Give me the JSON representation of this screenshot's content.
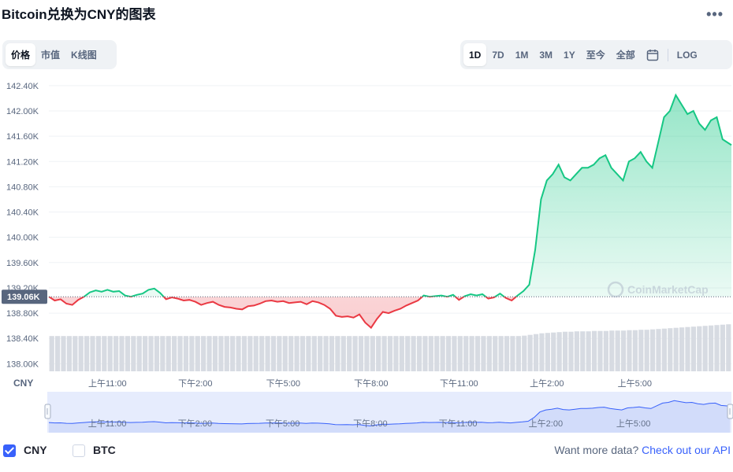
{
  "title": "Bitcoin兑换为CNY的图表",
  "more_icon": "more-horizontal-icon",
  "view_tabs": [
    {
      "label": "价格",
      "active": true
    },
    {
      "label": "市值",
      "active": false
    },
    {
      "label": "K线图",
      "active": false
    }
  ],
  "range_tabs": [
    {
      "label": "1D",
      "active": true
    },
    {
      "label": "7D",
      "active": false
    },
    {
      "label": "1M",
      "active": false
    },
    {
      "label": "3M",
      "active": false
    },
    {
      "label": "1Y",
      "active": false
    },
    {
      "label": "至今",
      "active": false
    },
    {
      "label": "全部",
      "active": false
    }
  ],
  "calendar_icon": "calendar-icon",
  "log_label": "LOG",
  "watermark": "CoinMarketCap",
  "colors": {
    "up": "#16c784",
    "down": "#ea3943",
    "accent": "#3861fb",
    "volume": "#d7dbe2",
    "navigator": "#e6ecfd"
  },
  "footer": {
    "currency_options": [
      {
        "label": "CNY",
        "checked": true
      },
      {
        "label": "BTC",
        "checked": false
      }
    ],
    "more_text": "Want more data?",
    "api_link": "Check out our API"
  },
  "chart_data": {
    "type": "area",
    "ylabel": "CNY",
    "y_ticks": [
      "142.40K",
      "142.00K",
      "141.60K",
      "141.20K",
      "140.80K",
      "140.40K",
      "140.00K",
      "139.60K",
      "139.20K",
      "138.80K",
      "138.40K",
      "138.00K"
    ],
    "y_tick_values": [
      142400,
      142000,
      141600,
      141200,
      140800,
      140400,
      140000,
      139600,
      139200,
      138800,
      138400,
      138000
    ],
    "ylim": [
      137880,
      142560
    ],
    "x_ticks": [
      "上午11:00",
      "下午2:00",
      "下午5:00",
      "下午8:00",
      "下午11:00",
      "上午2:00",
      "上午5:00"
    ],
    "x_tick_hours": [
      11,
      14,
      17,
      20,
      23,
      26,
      29
    ],
    "xlim_hours": [
      9.0,
      32.3
    ],
    "baseline": 139060,
    "baseline_label": "139.06K",
    "grid": true,
    "legend": "none",
    "series": [
      {
        "x": [
          9.0,
          9.2,
          9.4,
          9.6,
          9.8,
          10.0,
          10.2,
          10.4,
          10.6,
          10.8,
          11.0,
          11.2,
          11.4,
          11.6,
          11.8,
          12.0,
          12.2,
          12.4,
          12.6,
          12.8,
          13.0,
          13.2,
          13.4,
          13.6,
          13.8,
          14.0,
          14.2,
          14.4,
          14.6,
          14.8,
          15.0,
          15.2,
          15.4,
          15.6,
          15.8,
          16.0,
          16.2,
          16.4,
          16.6,
          16.8,
          17.0,
          17.2,
          17.4,
          17.6,
          17.8,
          18.0,
          18.2,
          18.4,
          18.6,
          18.8,
          19.0,
          19.2,
          19.4,
          19.6,
          19.8,
          20.0,
          20.2,
          20.4,
          20.6,
          20.8,
          21.0,
          21.2,
          21.4,
          21.6,
          21.8,
          22.0,
          22.2,
          22.4,
          22.6,
          22.8,
          23.0,
          23.2,
          23.4,
          23.6,
          23.8,
          24.0,
          24.2,
          24.4,
          24.6,
          24.8,
          25.0,
          25.2,
          25.4,
          25.6,
          25.8,
          26.0,
          26.2,
          26.4,
          26.6,
          26.8,
          27.0,
          27.2,
          27.4,
          27.6,
          27.8,
          28.0,
          28.2,
          28.4,
          28.6,
          28.8,
          29.0,
          29.2,
          29.4,
          29.6,
          29.8,
          30.0,
          30.2,
          30.4,
          30.6,
          30.8,
          31.0,
          31.2,
          31.4,
          31.6,
          31.8,
          32.0,
          32.3
        ],
        "y": [
          139060,
          139000,
          139020,
          138950,
          138930,
          139010,
          139060,
          139130,
          139160,
          139140,
          139170,
          139140,
          139150,
          139080,
          139060,
          139090,
          139110,
          139170,
          139190,
          139120,
          139020,
          139050,
          139030,
          139000,
          139010,
          138980,
          138930,
          138960,
          138980,
          138930,
          138900,
          138890,
          138870,
          138860,
          138910,
          138920,
          138950,
          138990,
          139000,
          138980,
          138990,
          138960,
          138970,
          138980,
          138940,
          138990,
          138970,
          138930,
          138870,
          138760,
          138740,
          138750,
          138730,
          138780,
          138650,
          138570,
          138710,
          138820,
          138800,
          138840,
          138870,
          138920,
          138960,
          139000,
          139080,
          139060,
          139070,
          139080,
          139060,
          139090,
          139010,
          139070,
          139100,
          139080,
          139100,
          139030,
          139050,
          139110,
          139040,
          139000,
          139080,
          139150,
          139250,
          139800,
          140600,
          140900,
          141000,
          141150,
          140950,
          140900,
          141000,
          141100,
          141100,
          141150,
          141250,
          141300,
          141100,
          141000,
          140900,
          141200,
          141250,
          141350,
          141200,
          141100,
          141500,
          141900,
          142000,
          142250,
          142100,
          141950,
          142000,
          141800,
          141700,
          141850,
          141900,
          141550,
          141460
        ]
      }
    ],
    "volume": [
      0.9,
      0.9,
      0.9,
      0.9,
      0.9,
      0.9,
      0.9,
      0.9,
      0.9,
      0.9,
      0.9,
      0.9,
      0.9,
      0.9,
      0.9,
      0.9,
      0.9,
      0.9,
      0.9,
      0.9,
      0.9,
      0.9,
      0.9,
      0.9,
      0.9,
      0.9,
      0.9,
      0.9,
      0.9,
      0.9,
      0.9,
      0.9,
      0.9,
      0.9,
      0.9,
      0.9,
      0.9,
      0.9,
      0.9,
      0.9,
      0.9,
      0.9,
      0.9,
      0.9,
      0.9,
      0.9,
      0.9,
      0.9,
      0.9,
      0.9,
      0.9,
      0.9,
      0.9,
      0.9,
      0.9,
      0.9,
      0.9,
      0.9,
      0.9,
      0.9,
      0.9,
      0.9,
      0.9,
      0.9,
      0.9,
      0.9,
      0.9,
      0.9,
      0.9,
      0.9,
      0.9,
      0.9,
      0.9,
      0.9,
      0.9,
      0.9,
      0.9,
      0.9,
      0.9,
      0.9,
      0.9,
      0.91,
      0.93,
      0.95,
      0.97,
      0.98,
      0.99,
      1.0,
      1.01,
      1.01,
      1.02,
      1.02,
      1.02,
      1.03,
      1.03,
      1.03,
      1.04,
      1.04,
      1.04,
      1.05,
      1.05,
      1.06,
      1.06,
      1.07,
      1.08,
      1.09,
      1.1,
      1.11,
      1.12,
      1.13,
      1.14,
      1.15,
      1.16,
      1.17,
      1.18,
      1.19,
      1.2
    ]
  }
}
